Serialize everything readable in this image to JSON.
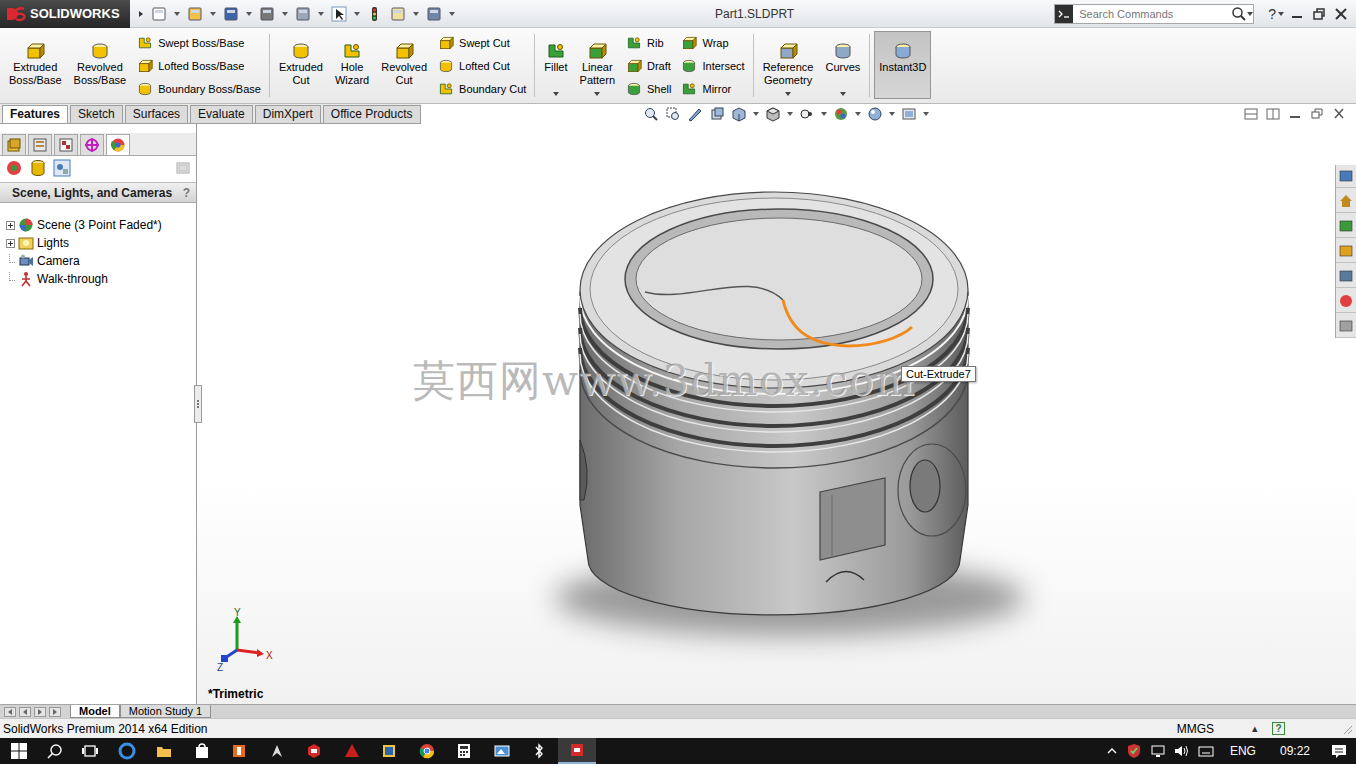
{
  "window": {
    "title": "Part1.SLDPRT",
    "logo": "SOLIDWORKS",
    "help": "?"
  },
  "search": {
    "placeholder": "Search Commands"
  },
  "ribbon": {
    "groups": [
      {
        "items": [
          {
            "kind": "large",
            "label": [
              "Extruded",
              "Boss/Base"
            ],
            "dropdown": false,
            "selected": false
          },
          {
            "kind": "large",
            "label": [
              "Revolved",
              "Boss/Base"
            ],
            "dropdown": false,
            "selected": false
          },
          {
            "kind": "column",
            "entries": [
              "Swept Boss/Base",
              "Lofted Boss/Base",
              "Boundary Boss/Base"
            ]
          }
        ]
      },
      {
        "items": [
          {
            "kind": "large",
            "label": [
              "Extruded",
              "Cut"
            ],
            "dropdown": false,
            "selected": false
          },
          {
            "kind": "large",
            "label": [
              "Hole",
              "Wizard"
            ],
            "dropdown": false,
            "selected": false
          },
          {
            "kind": "large",
            "label": [
              "Revolved",
              "Cut"
            ],
            "dropdown": false,
            "selected": false
          },
          {
            "kind": "column",
            "entries": [
              "Swept Cut",
              "Lofted Cut",
              "Boundary Cut"
            ]
          }
        ]
      },
      {
        "items": [
          {
            "kind": "large",
            "label": [
              "Fillet"
            ],
            "dropdown": true,
            "selected": false
          },
          {
            "kind": "large",
            "label": [
              "Linear",
              "Pattern"
            ],
            "dropdown": true,
            "selected": false
          },
          {
            "kind": "column",
            "entries": [
              "Rib",
              "Draft",
              "Shell"
            ]
          },
          {
            "kind": "column",
            "entries": [
              "Wrap",
              "Intersect",
              "Mirror"
            ]
          }
        ]
      },
      {
        "items": [
          {
            "kind": "large",
            "label": [
              "Reference",
              "Geometry"
            ],
            "dropdown": true,
            "selected": false
          },
          {
            "kind": "large",
            "label": [
              "Curves"
            ],
            "dropdown": true,
            "selected": false
          }
        ]
      },
      {
        "items": [
          {
            "kind": "large",
            "label": [
              "Instant3D"
            ],
            "dropdown": false,
            "selected": true
          }
        ]
      }
    ]
  },
  "command_tabs": [
    {
      "label": "Features",
      "selected": true
    },
    {
      "label": "Sketch",
      "selected": false
    },
    {
      "label": "Surfaces",
      "selected": false
    },
    {
      "label": "Evaluate",
      "selected": false
    },
    {
      "label": "DimXpert",
      "selected": false
    },
    {
      "label": "Office Products",
      "selected": false
    }
  ],
  "panel": {
    "tabs": [
      {
        "selected": false
      },
      {
        "selected": false
      },
      {
        "selected": false
      },
      {
        "selected": false
      },
      {
        "selected": true
      }
    ],
    "title": "Scene, Lights, and Cameras",
    "help": "?",
    "tree": [
      {
        "label": "Scene (3 Point Faded*)",
        "expandable": true,
        "expanded": false
      },
      {
        "label": "Lights",
        "expandable": true,
        "expanded": false
      },
      {
        "label": "Camera",
        "expandable": false,
        "expanded": false
      },
      {
        "label": "Walk-through",
        "expandable": false,
        "expanded": false
      }
    ]
  },
  "viewport": {
    "view_label": "*Trimetric",
    "tooltip": "Cut-Extrude7",
    "watermark": "莫西网www.3dmox.com",
    "axes": [
      "Y",
      "X",
      "Z"
    ]
  },
  "bottom_tabs": [
    {
      "label": "Model",
      "selected": true
    },
    {
      "label": "Motion Study 1",
      "selected": false
    }
  ],
  "status_bar": {
    "edition": "SolidWorks Premium 2014 x64 Edition",
    "units": "MMGS",
    "units_arrow": "▴",
    "help": "?"
  },
  "taskbar": {
    "apps": [
      {
        "selected": false
      },
      {
        "selected": false
      },
      {
        "selected": false
      },
      {
        "selected": false
      },
      {
        "selected": false
      },
      {
        "selected": false
      },
      {
        "selected": false
      },
      {
        "selected": false
      },
      {
        "selected": false
      },
      {
        "selected": false
      },
      {
        "selected": false
      },
      {
        "selected": false
      },
      {
        "selected": true
      }
    ],
    "language": "ENG",
    "time": "09:22"
  }
}
